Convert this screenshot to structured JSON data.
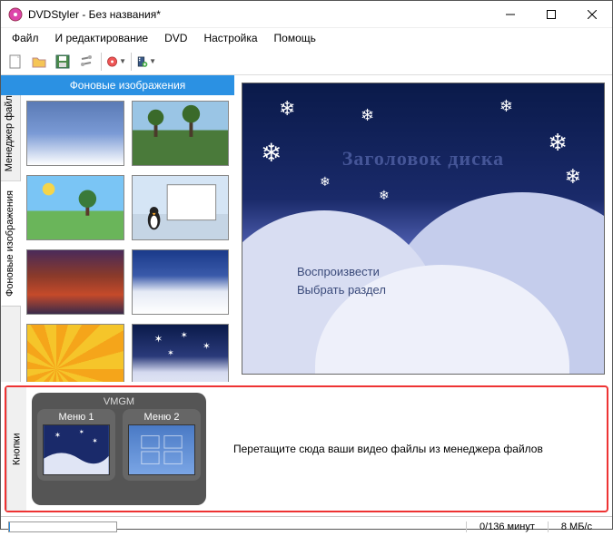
{
  "window": {
    "title": "DVDStyler - Без названия*"
  },
  "menubar": {
    "items": [
      "Файл",
      "И редактирование",
      "DVD",
      "Настройка",
      "Помощь"
    ]
  },
  "sidetabs": {
    "file_manager": "Менеджер файлов",
    "backgrounds": "Фоновые изображения",
    "buttons": "Кнопки"
  },
  "bg_panel": {
    "header": "Фоновые изображения"
  },
  "preview": {
    "disc_title": "Заголовок диска",
    "option_play": "Воспроизвести",
    "option_select": "Выбрать раздел"
  },
  "bottom": {
    "vmgm_label": "VMGM",
    "menu1_label": "Меню 1",
    "menu2_label": "Меню 2",
    "drop_text": "Перетащите сюда ваши видео файлы из менеджера файлов"
  },
  "statusbar": {
    "duration": "0/136 минут",
    "bitrate": "8 МБ/с"
  }
}
